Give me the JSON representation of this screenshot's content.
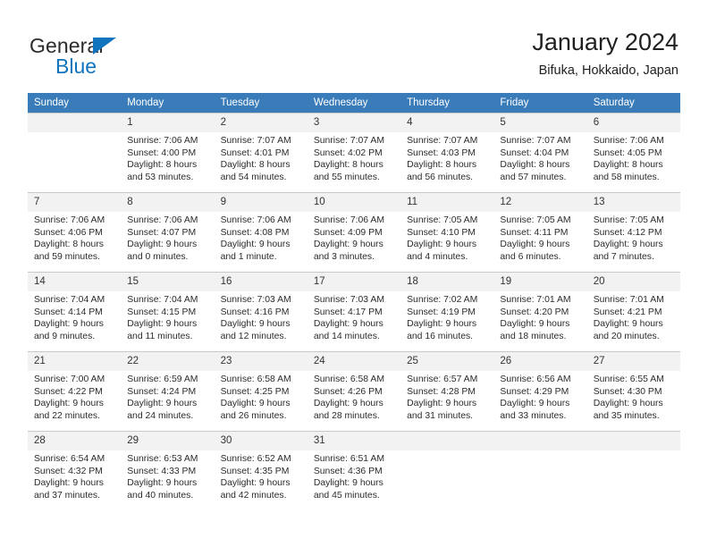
{
  "brand": {
    "name_part1": "General",
    "name_part2": "Blue",
    "accent_color": "#0f73bd"
  },
  "header": {
    "title": "January 2024",
    "subtitle": "Bifuka, Hokkaido, Japan"
  },
  "theme": {
    "header_row_bg": "#3a7cb9",
    "daynum_bg": "#f2f2f2",
    "grid_line": "#c8c8c8",
    "text": "#2b2b2b"
  },
  "weekdays": [
    "Sunday",
    "Monday",
    "Tuesday",
    "Wednesday",
    "Thursday",
    "Friday",
    "Saturday"
  ],
  "labels": {
    "sunrise": "Sunrise:",
    "sunset": "Sunset:",
    "daylight": "Daylight:"
  },
  "weeks": [
    [
      {
        "day": "",
        "empty": true
      },
      {
        "day": "1",
        "sunrise": "Sunrise: 7:06 AM",
        "sunset": "Sunset: 4:00 PM",
        "daylight1": "Daylight: 8 hours",
        "daylight2": "and 53 minutes."
      },
      {
        "day": "2",
        "sunrise": "Sunrise: 7:07 AM",
        "sunset": "Sunset: 4:01 PM",
        "daylight1": "Daylight: 8 hours",
        "daylight2": "and 54 minutes."
      },
      {
        "day": "3",
        "sunrise": "Sunrise: 7:07 AM",
        "sunset": "Sunset: 4:02 PM",
        "daylight1": "Daylight: 8 hours",
        "daylight2": "and 55 minutes."
      },
      {
        "day": "4",
        "sunrise": "Sunrise: 7:07 AM",
        "sunset": "Sunset: 4:03 PM",
        "daylight1": "Daylight: 8 hours",
        "daylight2": "and 56 minutes."
      },
      {
        "day": "5",
        "sunrise": "Sunrise: 7:07 AM",
        "sunset": "Sunset: 4:04 PM",
        "daylight1": "Daylight: 8 hours",
        "daylight2": "and 57 minutes."
      },
      {
        "day": "6",
        "sunrise": "Sunrise: 7:06 AM",
        "sunset": "Sunset: 4:05 PM",
        "daylight1": "Daylight: 8 hours",
        "daylight2": "and 58 minutes."
      }
    ],
    [
      {
        "day": "7",
        "sunrise": "Sunrise: 7:06 AM",
        "sunset": "Sunset: 4:06 PM",
        "daylight1": "Daylight: 8 hours",
        "daylight2": "and 59 minutes."
      },
      {
        "day": "8",
        "sunrise": "Sunrise: 7:06 AM",
        "sunset": "Sunset: 4:07 PM",
        "daylight1": "Daylight: 9 hours",
        "daylight2": "and 0 minutes."
      },
      {
        "day": "9",
        "sunrise": "Sunrise: 7:06 AM",
        "sunset": "Sunset: 4:08 PM",
        "daylight1": "Daylight: 9 hours",
        "daylight2": "and 1 minute."
      },
      {
        "day": "10",
        "sunrise": "Sunrise: 7:06 AM",
        "sunset": "Sunset: 4:09 PM",
        "daylight1": "Daylight: 9 hours",
        "daylight2": "and 3 minutes."
      },
      {
        "day": "11",
        "sunrise": "Sunrise: 7:05 AM",
        "sunset": "Sunset: 4:10 PM",
        "daylight1": "Daylight: 9 hours",
        "daylight2": "and 4 minutes."
      },
      {
        "day": "12",
        "sunrise": "Sunrise: 7:05 AM",
        "sunset": "Sunset: 4:11 PM",
        "daylight1": "Daylight: 9 hours",
        "daylight2": "and 6 minutes."
      },
      {
        "day": "13",
        "sunrise": "Sunrise: 7:05 AM",
        "sunset": "Sunset: 4:12 PM",
        "daylight1": "Daylight: 9 hours",
        "daylight2": "and 7 minutes."
      }
    ],
    [
      {
        "day": "14",
        "sunrise": "Sunrise: 7:04 AM",
        "sunset": "Sunset: 4:14 PM",
        "daylight1": "Daylight: 9 hours",
        "daylight2": "and 9 minutes."
      },
      {
        "day": "15",
        "sunrise": "Sunrise: 7:04 AM",
        "sunset": "Sunset: 4:15 PM",
        "daylight1": "Daylight: 9 hours",
        "daylight2": "and 11 minutes."
      },
      {
        "day": "16",
        "sunrise": "Sunrise: 7:03 AM",
        "sunset": "Sunset: 4:16 PM",
        "daylight1": "Daylight: 9 hours",
        "daylight2": "and 12 minutes."
      },
      {
        "day": "17",
        "sunrise": "Sunrise: 7:03 AM",
        "sunset": "Sunset: 4:17 PM",
        "daylight1": "Daylight: 9 hours",
        "daylight2": "and 14 minutes."
      },
      {
        "day": "18",
        "sunrise": "Sunrise: 7:02 AM",
        "sunset": "Sunset: 4:19 PM",
        "daylight1": "Daylight: 9 hours",
        "daylight2": "and 16 minutes."
      },
      {
        "day": "19",
        "sunrise": "Sunrise: 7:01 AM",
        "sunset": "Sunset: 4:20 PM",
        "daylight1": "Daylight: 9 hours",
        "daylight2": "and 18 minutes."
      },
      {
        "day": "20",
        "sunrise": "Sunrise: 7:01 AM",
        "sunset": "Sunset: 4:21 PM",
        "daylight1": "Daylight: 9 hours",
        "daylight2": "and 20 minutes."
      }
    ],
    [
      {
        "day": "21",
        "sunrise": "Sunrise: 7:00 AM",
        "sunset": "Sunset: 4:22 PM",
        "daylight1": "Daylight: 9 hours",
        "daylight2": "and 22 minutes."
      },
      {
        "day": "22",
        "sunrise": "Sunrise: 6:59 AM",
        "sunset": "Sunset: 4:24 PM",
        "daylight1": "Daylight: 9 hours",
        "daylight2": "and 24 minutes."
      },
      {
        "day": "23",
        "sunrise": "Sunrise: 6:58 AM",
        "sunset": "Sunset: 4:25 PM",
        "daylight1": "Daylight: 9 hours",
        "daylight2": "and 26 minutes."
      },
      {
        "day": "24",
        "sunrise": "Sunrise: 6:58 AM",
        "sunset": "Sunset: 4:26 PM",
        "daylight1": "Daylight: 9 hours",
        "daylight2": "and 28 minutes."
      },
      {
        "day": "25",
        "sunrise": "Sunrise: 6:57 AM",
        "sunset": "Sunset: 4:28 PM",
        "daylight1": "Daylight: 9 hours",
        "daylight2": "and 31 minutes."
      },
      {
        "day": "26",
        "sunrise": "Sunrise: 6:56 AM",
        "sunset": "Sunset: 4:29 PM",
        "daylight1": "Daylight: 9 hours",
        "daylight2": "and 33 minutes."
      },
      {
        "day": "27",
        "sunrise": "Sunrise: 6:55 AM",
        "sunset": "Sunset: 4:30 PM",
        "daylight1": "Daylight: 9 hours",
        "daylight2": "and 35 minutes."
      }
    ],
    [
      {
        "day": "28",
        "sunrise": "Sunrise: 6:54 AM",
        "sunset": "Sunset: 4:32 PM",
        "daylight1": "Daylight: 9 hours",
        "daylight2": "and 37 minutes."
      },
      {
        "day": "29",
        "sunrise": "Sunrise: 6:53 AM",
        "sunset": "Sunset: 4:33 PM",
        "daylight1": "Daylight: 9 hours",
        "daylight2": "and 40 minutes."
      },
      {
        "day": "30",
        "sunrise": "Sunrise: 6:52 AM",
        "sunset": "Sunset: 4:35 PM",
        "daylight1": "Daylight: 9 hours",
        "daylight2": "and 42 minutes."
      },
      {
        "day": "31",
        "sunrise": "Sunrise: 6:51 AM",
        "sunset": "Sunset: 4:36 PM",
        "daylight1": "Daylight: 9 hours",
        "daylight2": "and 45 minutes."
      },
      {
        "day": "",
        "empty": true
      },
      {
        "day": "",
        "empty": true
      },
      {
        "day": "",
        "empty": true
      }
    ]
  ]
}
